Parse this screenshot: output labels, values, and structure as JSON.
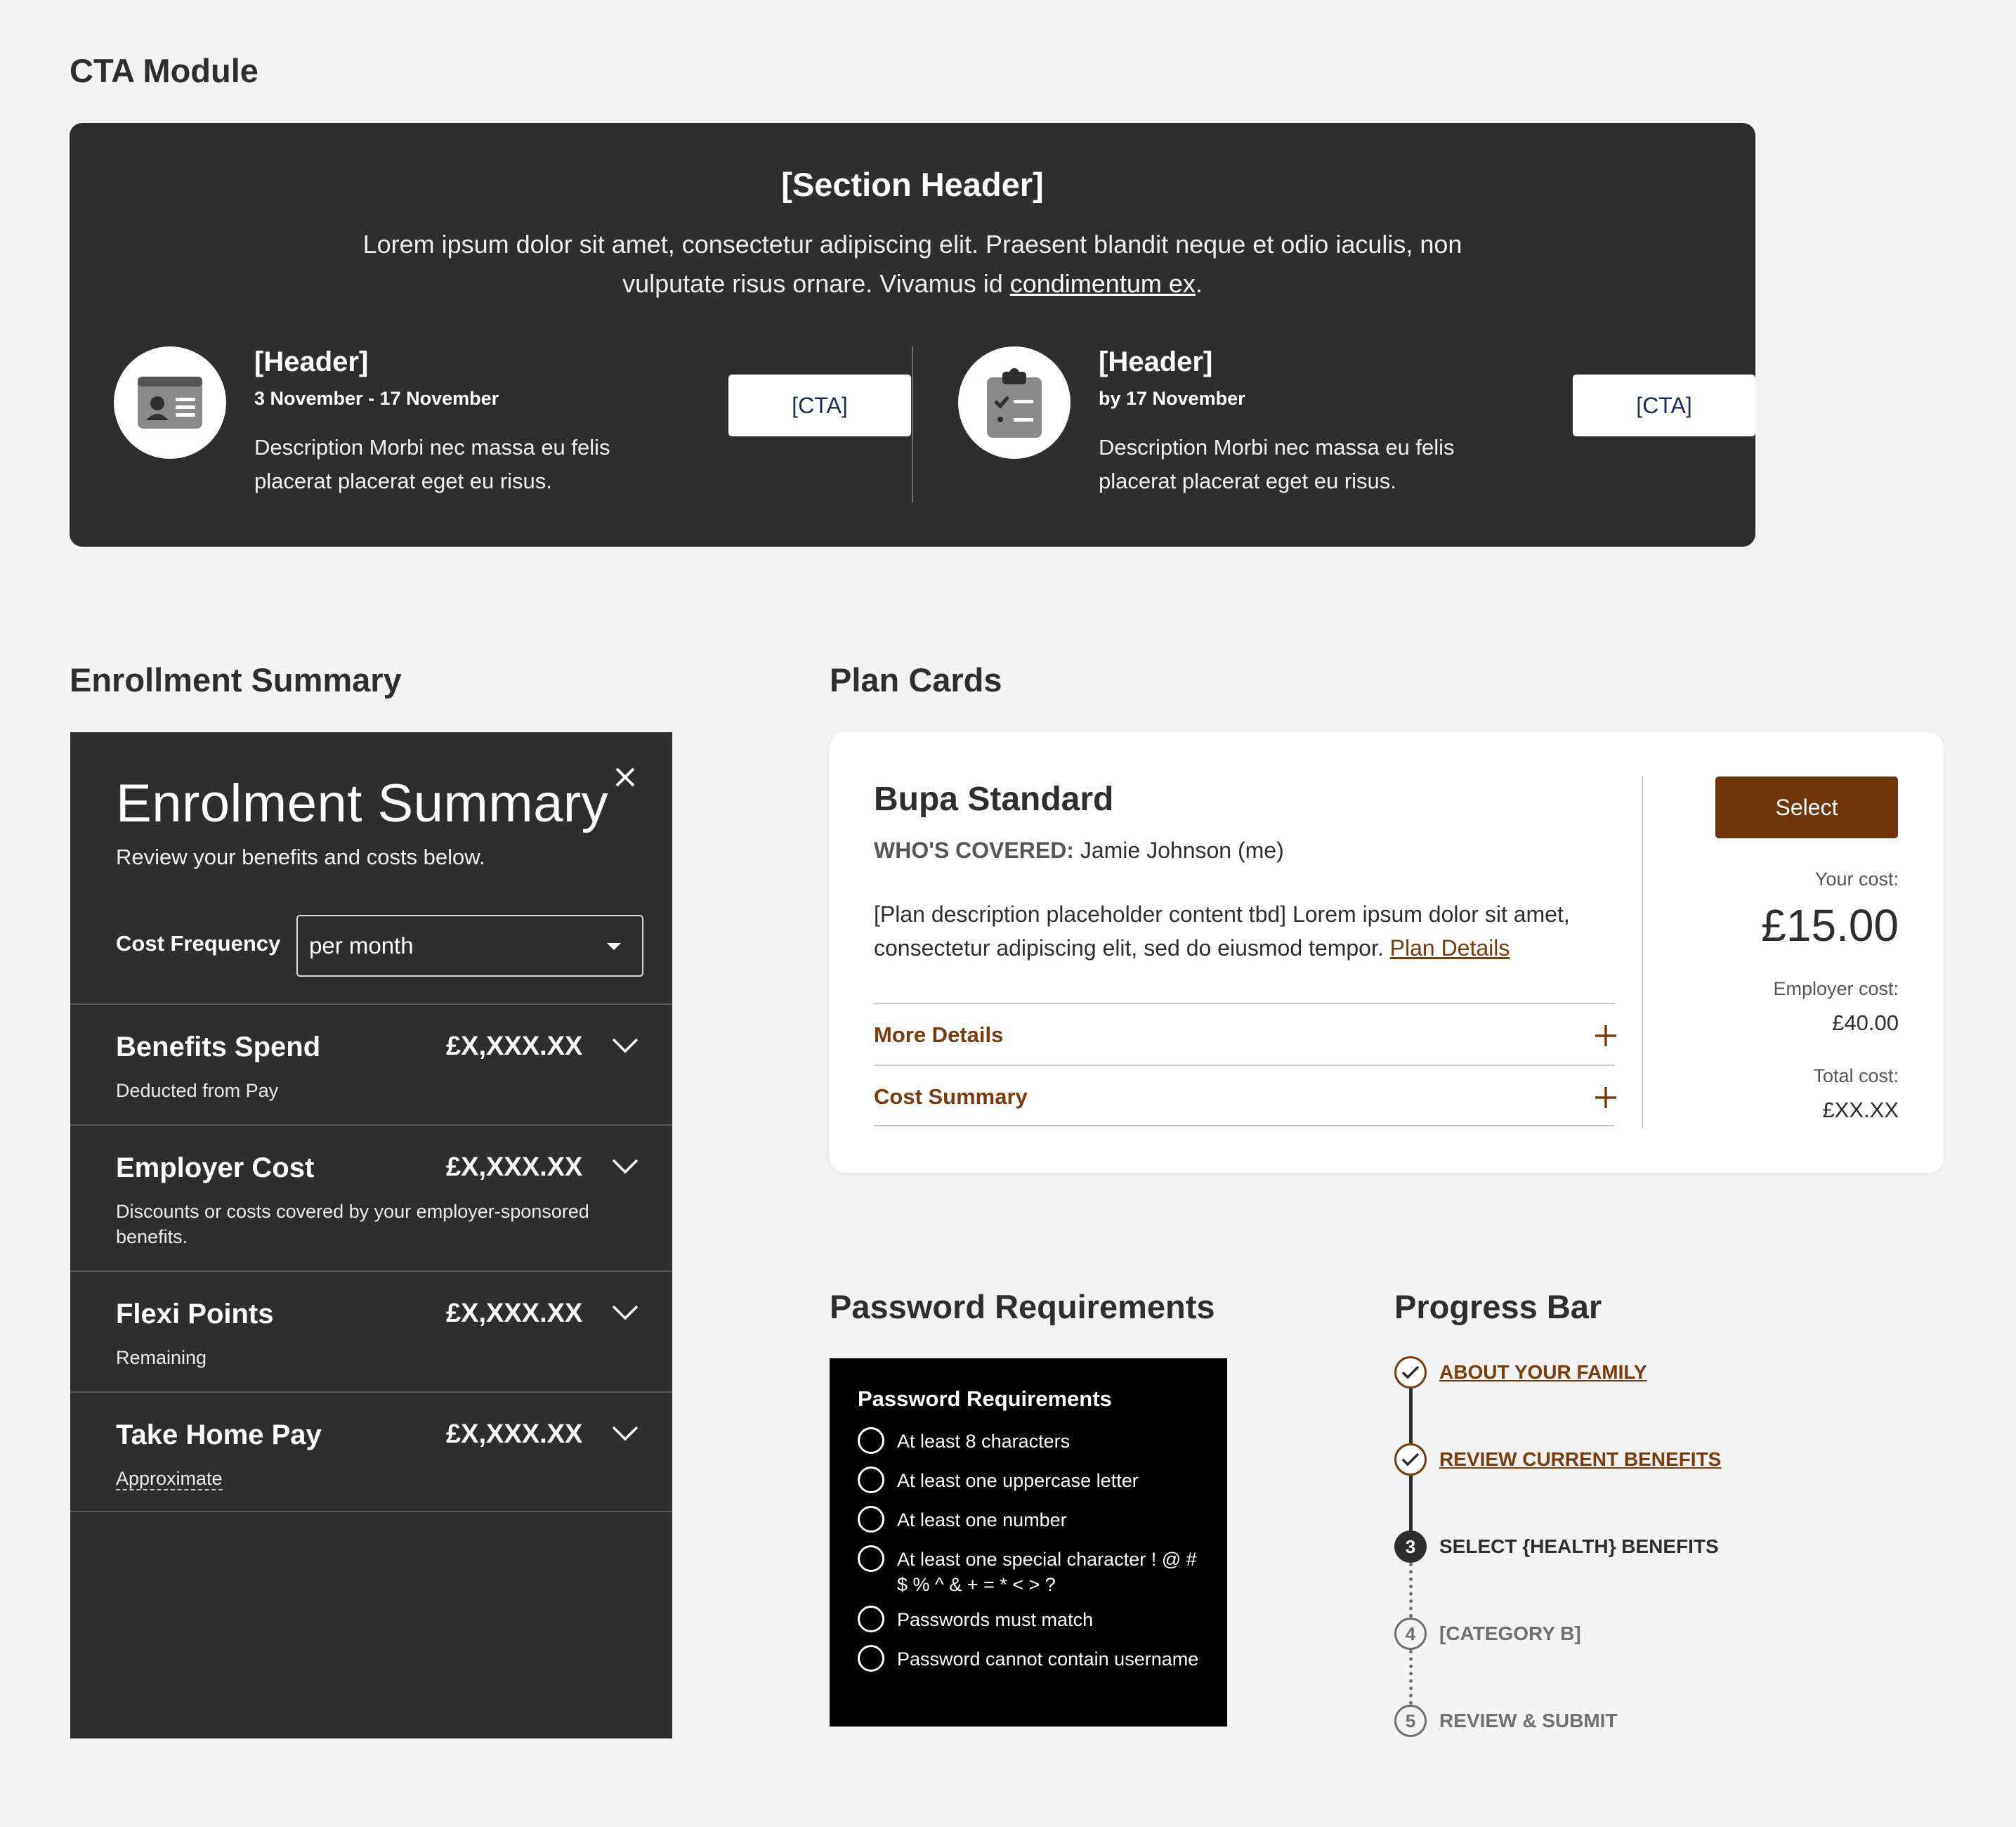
{
  "sections": {
    "cta": "CTA Module",
    "enrollment": "Enrollment Summary",
    "plan_cards": "Plan Cards",
    "password": "Password Requirements",
    "progress": "Progress Bar"
  },
  "cta_module": {
    "section_header": "[Section Header]",
    "intro_text": "Lorem ipsum dolor sit amet, consectetur adipiscing elit. Praesent blandit neque et odio iaculis, non vulputate risus ornare. Vivamus id ",
    "intro_link": "condimentum ex",
    "intro_end": ".",
    "items": [
      {
        "icon": "id-card-icon",
        "header": "[Header]",
        "date": "3 November - 17 November",
        "description": "Description Morbi nec massa eu felis placerat placerat eget eu risus.",
        "cta_label": "[CTA]"
      },
      {
        "icon": "clipboard-checklist-icon",
        "header": "[Header]",
        "date": "by 17 November",
        "description": "Description Morbi nec massa eu felis placerat placerat eget eu risus.",
        "cta_label": "[CTA]"
      }
    ]
  },
  "enrolment_summary": {
    "title": "Enrolment Summary",
    "subtitle": "Review your benefits and costs below.",
    "cost_frequency_label": "Cost Frequency",
    "cost_frequency_value": "per month",
    "rows": [
      {
        "title": "Benefits Spend",
        "amount": "£X,XXX.XX",
        "description": "Deducted from Pay"
      },
      {
        "title": "Employer Cost",
        "amount": "£X,XXX.XX",
        "description": "Discounts or costs covered by your employer-sponsored benefits."
      },
      {
        "title": "Flexi Points",
        "amount": "£X,XXX.XX",
        "description": "Remaining"
      },
      {
        "title": "Take Home Pay",
        "amount": "£X,XXX.XX",
        "description": "Approximate"
      }
    ]
  },
  "plan_card": {
    "title": "Bupa Standard",
    "covered_label": "WHO'S COVERED:",
    "covered_value": " Jamie Johnson (me)",
    "description": "[Plan description placeholder content tbd] Lorem ipsum dolor sit amet, consectetur adipiscing elit, sed do eiusmod tempor. ",
    "details_link": "Plan Details",
    "accordions": [
      "More Details",
      "Cost Summary"
    ],
    "select_label": "Select",
    "your_cost_label": "Your cost:",
    "your_cost_value": "£15.00",
    "employer_cost_label": "Employer cost:",
    "employer_cost_value": "£40.00",
    "total_cost_label": "Total cost:",
    "total_cost_value": "£XX.XX",
    "accent_color": "#7a3b0d"
  },
  "password_requirements": {
    "title": "Password Requirements",
    "items": [
      "At least 8 characters",
      "At least one uppercase letter",
      "At least one number",
      "At least one special character ! @ # $ % ^ & + = * < > ?",
      "Passwords must match",
      "Password cannot contain username"
    ]
  },
  "progress_bar": {
    "steps": [
      {
        "label": "ABOUT YOUR FAMILY",
        "state": "done"
      },
      {
        "label": "REVIEW CURRENT BENEFITS",
        "state": "done"
      },
      {
        "number": "3",
        "label": "SELECT {HEALTH} BENEFITS",
        "state": "current"
      },
      {
        "number": "4",
        "label": "[CATEGORY B]",
        "state": "todo"
      },
      {
        "number": "5",
        "label": "REVIEW & SUBMIT",
        "state": "todo"
      }
    ]
  }
}
